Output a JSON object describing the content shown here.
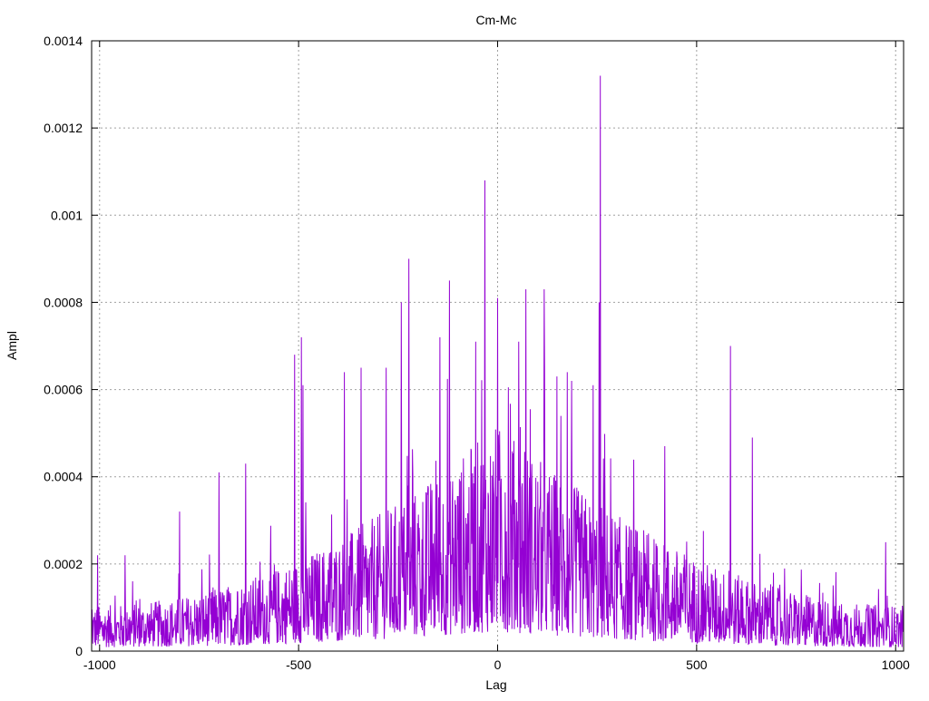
{
  "chart_data": {
    "type": "line",
    "title": "Cm-Mc",
    "xlabel": "Lag",
    "ylabel": "Ampl",
    "xlim": [
      -1020,
      1020
    ],
    "ylim": [
      0,
      0.0014
    ],
    "xticks": [
      {
        "value": -1000,
        "label": "-1000"
      },
      {
        "value": -500,
        "label": "-500"
      },
      {
        "value": 0,
        "label": "0"
      },
      {
        "value": 500,
        "label": "500"
      },
      {
        "value": 1000,
        "label": "1000"
      }
    ],
    "yticks": [
      {
        "value": 0,
        "label": "0"
      },
      {
        "value": 0.0002,
        "label": "0.0002"
      },
      {
        "value": 0.0004,
        "label": "0.0004"
      },
      {
        "value": 0.0006,
        "label": "0.0006"
      },
      {
        "value": 0.0008,
        "label": "0.0008"
      },
      {
        "value": 0.001,
        "label": "0.001"
      },
      {
        "value": 0.0012,
        "label": "0.0012"
      },
      {
        "value": 0.0014,
        "label": "0.0014"
      }
    ],
    "grid": true,
    "legend": "none",
    "series_color": "#9400D3",
    "series": [
      {
        "x_start": -1020,
        "x_step": 1,
        "peaks": [
          {
            "x": 258,
            "y": 0.00132
          },
          {
            "x": -32,
            "y": 0.00108
          },
          {
            "x": -223,
            "y": 0.0009
          },
          {
            "x": -121,
            "y": 0.00085
          },
          {
            "x": 117,
            "y": 0.00083
          },
          {
            "x": 71,
            "y": 0.00083
          },
          {
            "x": 0,
            "y": 0.00081
          },
          {
            "x": -242,
            "y": 0.0008
          },
          {
            "x": 255,
            "y": 0.0008
          },
          {
            "x": -493,
            "y": 0.00072
          },
          {
            "x": -145,
            "y": 0.00072
          },
          {
            "x": -55,
            "y": 0.00071
          },
          {
            "x": 53,
            "y": 0.00071
          },
          {
            "x": 585,
            "y": 0.0007
          },
          {
            "x": -510,
            "y": 0.00068
          },
          {
            "x": -343,
            "y": 0.00065
          },
          {
            "x": -280,
            "y": 0.00065
          },
          {
            "x": -385,
            "y": 0.00064
          },
          {
            "x": 175,
            "y": 0.00064
          },
          {
            "x": 186,
            "y": 0.00062
          },
          {
            "x": -489,
            "y": 0.00061
          },
          {
            "x": 240,
            "y": 0.00061
          },
          {
            "x": -700,
            "y": 0.00041
          },
          {
            "x": -633,
            "y": 0.00043
          },
          {
            "x": 640,
            "y": 0.00049
          },
          {
            "x": 420,
            "y": 0.00047
          },
          {
            "x": -799,
            "y": 0.00032
          },
          {
            "x": 975,
            "y": 0.00025
          },
          {
            "x": -1005,
            "y": 0.00022
          },
          {
            "x": -936,
            "y": 0.00022
          }
        ]
      }
    ]
  }
}
